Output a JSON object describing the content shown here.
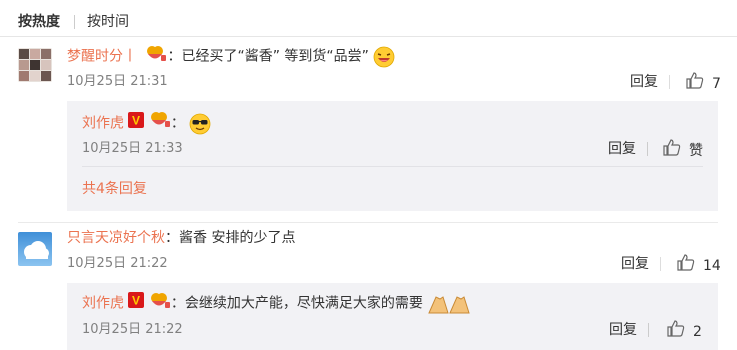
{
  "tabs": [
    {
      "label": "按热度",
      "active": true
    },
    {
      "label": "按时间",
      "active": false
    }
  ],
  "comments": [
    {
      "user": "梦醒时分丨",
      "text": "已经买了“酱香” 等到货“品尝”",
      "time": "10月25日 21:31",
      "reply_label": "回复",
      "like_count": "7",
      "replies": [
        {
          "user": "刘作虎",
          "text": "",
          "time": "10月25日 21:33",
          "reply_label": "回复",
          "like_label": "赞"
        }
      ],
      "more_label": "共4条回复"
    },
    {
      "user": "只言天凉好个秋",
      "text": "酱香 安排的少了点",
      "time": "10月25日 21:22",
      "reply_label": "回复",
      "like_count": "14",
      "replies": [
        {
          "user": "刘作虎",
          "text": "会继续加大产能，尽快满足大家的需要",
          "time": "10月25日 21:22",
          "reply_label": "回复",
          "like_count": "2"
        }
      ]
    }
  ],
  "colors": {
    "username": "#eb7350",
    "text": "#333333",
    "meta": "#808080",
    "reply_bg": "#f2f2f5",
    "vip_badge": "#f5a623",
    "verified_badge": "#d9181a"
  },
  "icons": {
    "like": "thumbs-up-icon",
    "fan_badge": "heart-hands-badge-icon",
    "verified": "verified-v-badge-icon",
    "laugh_emoji": "laughing-emoji-icon",
    "cool_emoji": "sunglasses-emoji-icon",
    "clap_emoji": "clapping-hands-emoji-icon"
  }
}
